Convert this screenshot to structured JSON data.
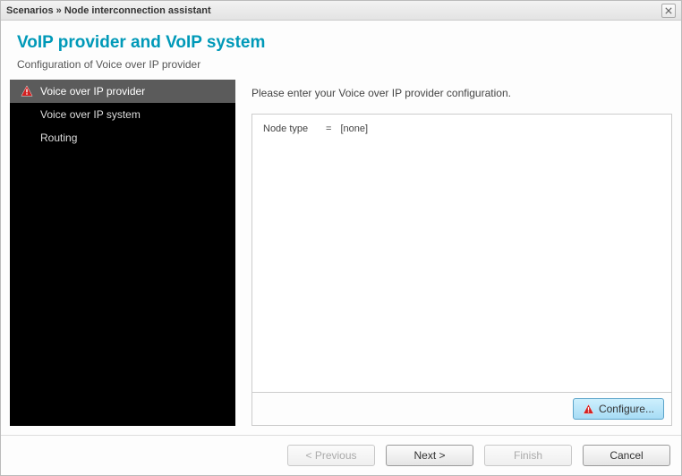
{
  "titlebar": {
    "text": "Scenarios » Node interconnection assistant"
  },
  "header": {
    "title": "VoIP provider and VoIP system",
    "subtitle": "Configuration of Voice over IP provider"
  },
  "sidebar": {
    "items": [
      {
        "label": "Voice over IP provider",
        "active": true,
        "warning": true
      },
      {
        "label": "Voice over IP system",
        "active": false,
        "warning": false
      },
      {
        "label": "Routing",
        "active": false,
        "warning": false
      }
    ]
  },
  "content": {
    "instruction": "Please enter your Voice over IP provider configuration.",
    "config": {
      "node_type_label": "Node type",
      "equals": "=",
      "node_type_value": "[none]"
    },
    "configure_button": "Configure..."
  },
  "footer": {
    "previous": "< Previous",
    "next": "Next >",
    "finish": "Finish",
    "cancel": "Cancel"
  }
}
